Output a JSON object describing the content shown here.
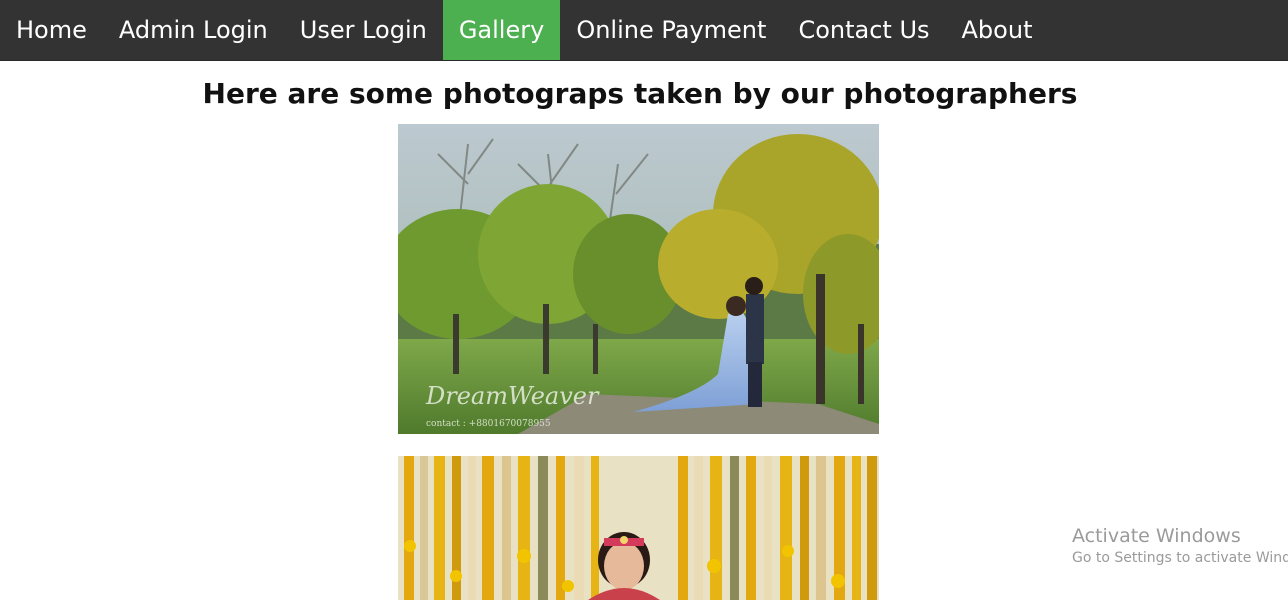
{
  "nav": {
    "items": [
      {
        "label": "Home"
      },
      {
        "label": "Admin Login"
      },
      {
        "label": "User Login"
      },
      {
        "label": "Gallery",
        "active": true
      },
      {
        "label": "Online Payment"
      },
      {
        "label": "Contact Us"
      },
      {
        "label": "About"
      }
    ],
    "colors": {
      "bar": "#333333",
      "active": "#4CAF50",
      "text": "#ffffff"
    }
  },
  "main": {
    "heading": "Here are some photograps taken by our photographers"
  },
  "gallery": {
    "photos": [
      {
        "watermark": "DreamWeaver",
        "contact": "contact : +8801670078955"
      },
      {}
    ]
  },
  "overlay": {
    "line1": "Activate Windows",
    "line2": "Go to Settings to activate Windows."
  }
}
